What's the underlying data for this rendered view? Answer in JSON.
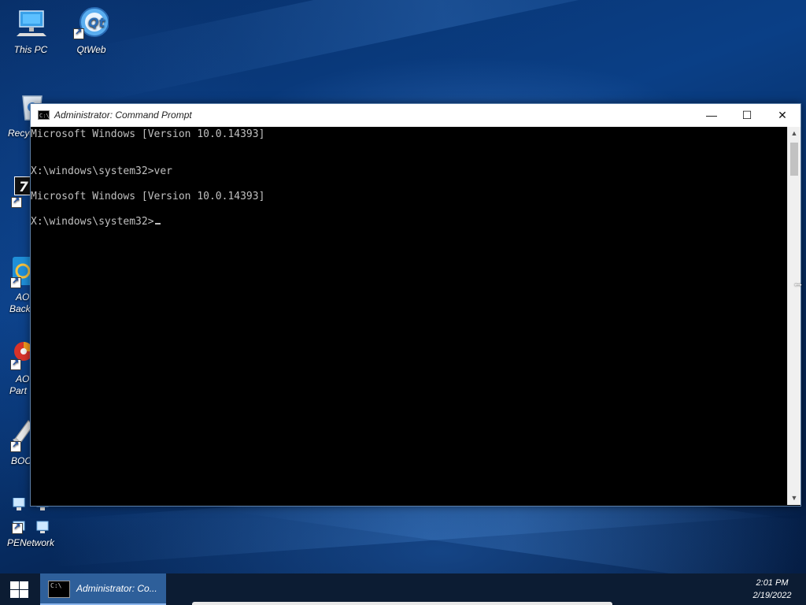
{
  "desktop": {
    "icons": [
      {
        "label": "This PC",
        "icon": "computer-icon"
      },
      {
        "label": "QtWeb",
        "icon": "qtweb-globe-icon"
      },
      {
        "label": "Recyc",
        "icon": "recycle-bin-icon"
      },
      {
        "label": "7",
        "icon": "seven-zip-icon"
      },
      {
        "label_line1": "AO",
        "label_line2": "Back",
        "icon": "backupper-icon"
      },
      {
        "label_line1": "AO",
        "label_line2": "Part",
        "icon": "partition-icon"
      },
      {
        "label": "BOC",
        "icon": "eraser-icon"
      },
      {
        "label": "PENetwork",
        "icon": "network-icon"
      }
    ]
  },
  "window": {
    "title": "Administrator: Command Prompt",
    "minimize_glyph": "—",
    "maximize_glyph": "☐",
    "close_glyph": "✕",
    "title_icon_text": "C:\\",
    "console_lines": [
      "Microsoft Windows [Version 10.0.14393]",
      "X:\\windows\\system32>ver",
      "Microsoft Windows [Version 10.0.14393]",
      "X:\\windows\\system32>"
    ]
  },
  "taskbar": {
    "task_label": "Administrator: Co...",
    "task_icon_text": "C:\\",
    "clock_time": "2:01 PM",
    "clock_date": "2/19/2022"
  },
  "colors": {
    "console_bg": "#000000",
    "console_fg": "#c0c0c0",
    "taskbar_bg": "#0c1c33",
    "task_active": "#2e5f9a"
  }
}
